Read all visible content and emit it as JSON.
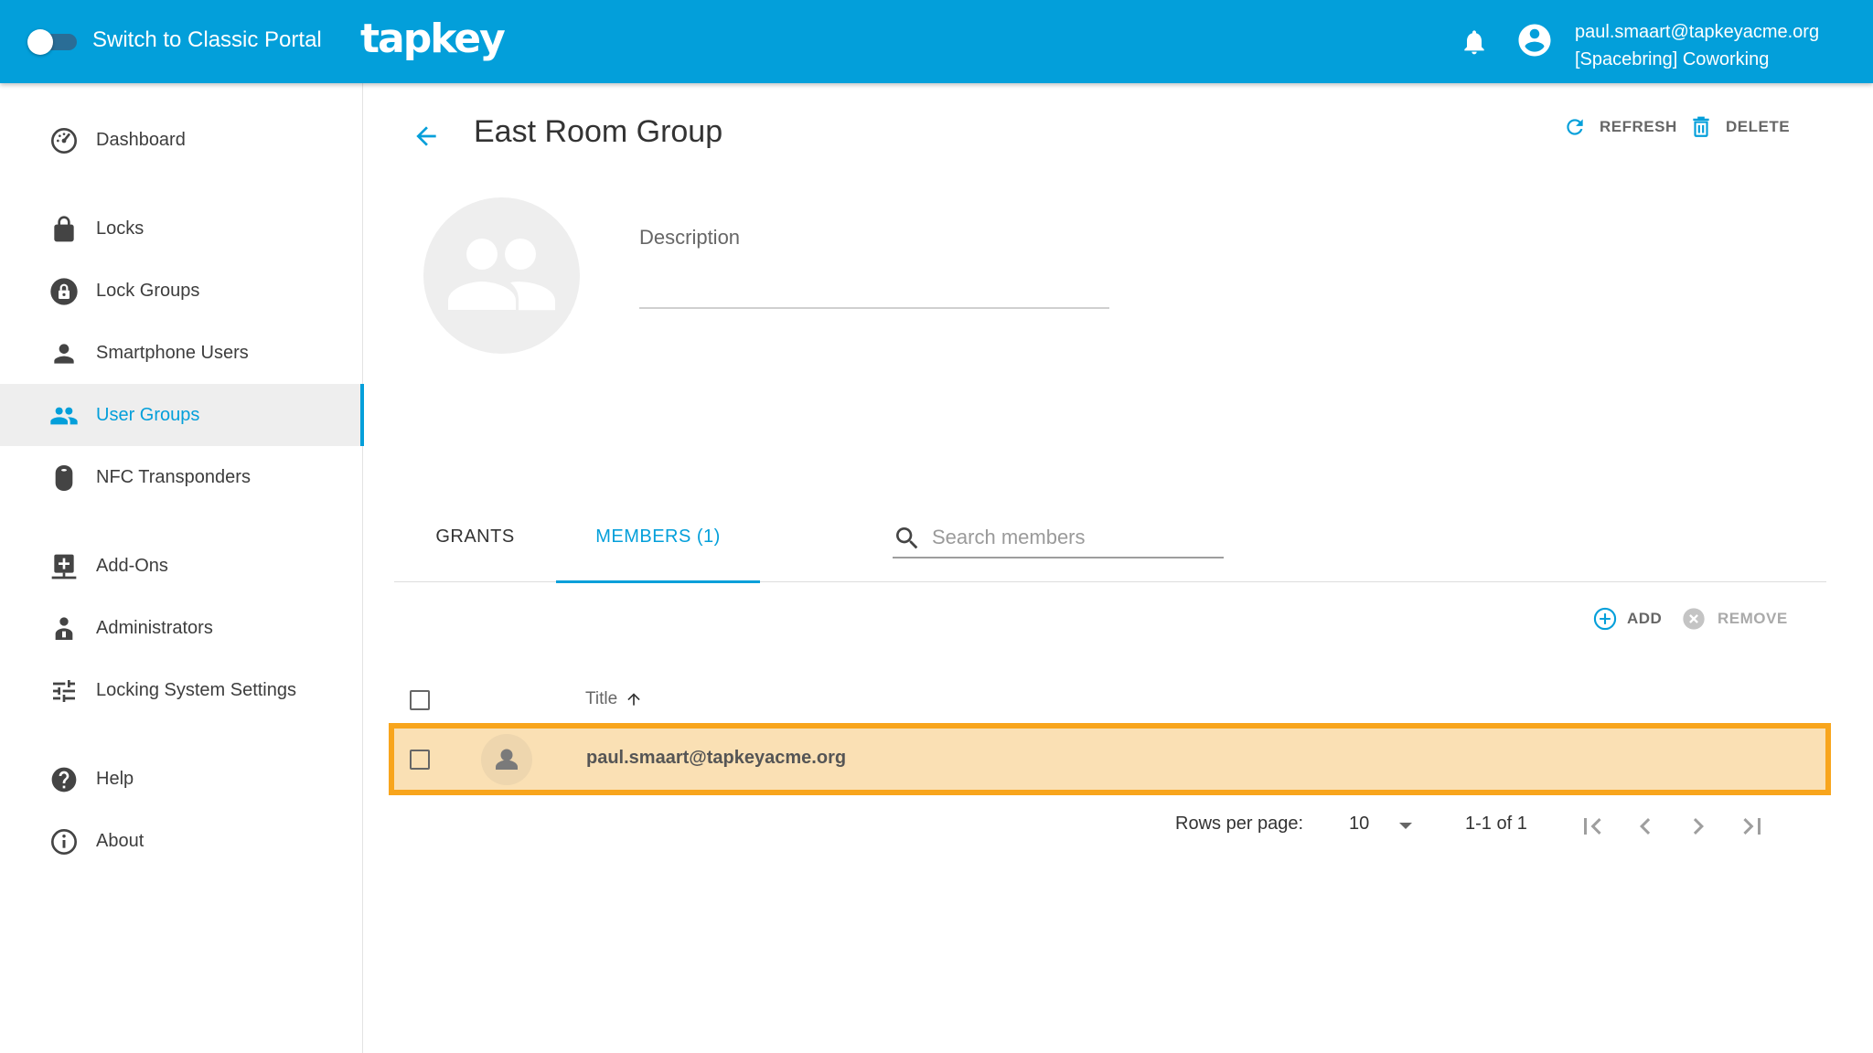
{
  "header": {
    "toggle_label": "Switch to Classic Portal",
    "logo": "tapkey",
    "user_email": "paul.smaart@tapkeyacme.org",
    "user_org": "[Spacebring] Coworking",
    "color": "#039fda"
  },
  "sidebar": {
    "items": [
      {
        "label": "Dashboard",
        "icon": "dashboard-icon"
      },
      {
        "label": "Locks",
        "icon": "lock-icon"
      },
      {
        "label": "Lock Groups",
        "icon": "lock-group-icon"
      },
      {
        "label": "Smartphone Users",
        "icon": "person-icon"
      },
      {
        "label": "User Groups",
        "icon": "people-icon",
        "active": true
      },
      {
        "label": "NFC Transponders",
        "icon": "transponder-icon"
      },
      {
        "label": "Add-Ons",
        "icon": "add-on-icon"
      },
      {
        "label": "Administrators",
        "icon": "admin-icon"
      },
      {
        "label": "Locking System Settings",
        "icon": "settings-sliders-icon"
      },
      {
        "label": "Help",
        "icon": "help-icon"
      },
      {
        "label": "About",
        "icon": "info-icon"
      }
    ]
  },
  "page": {
    "title": "East Room Group",
    "refresh_label": "REFRESH",
    "delete_label": "DELETE",
    "description_label": "Description",
    "description_value": ""
  },
  "tabs": [
    {
      "label": "GRANTS",
      "active": false
    },
    {
      "label": "MEMBERS (1)",
      "active": true
    }
  ],
  "members": {
    "search_placeholder": "Search members",
    "add_label": "ADD",
    "remove_label": "REMOVE",
    "column_title": "Title",
    "sort": "ascending",
    "rows": [
      {
        "title": "paul.smaart@tapkeyacme.org",
        "selected": false,
        "highlighted": true
      }
    ]
  },
  "pagination": {
    "rows_per_page_label": "Rows per page:",
    "rows_per_page": "10",
    "range": "1-1 of 1"
  },
  "colors": {
    "accent": "#039fda",
    "highlight_fill": "#fae0b4",
    "highlight_border": "#f8a51c"
  }
}
